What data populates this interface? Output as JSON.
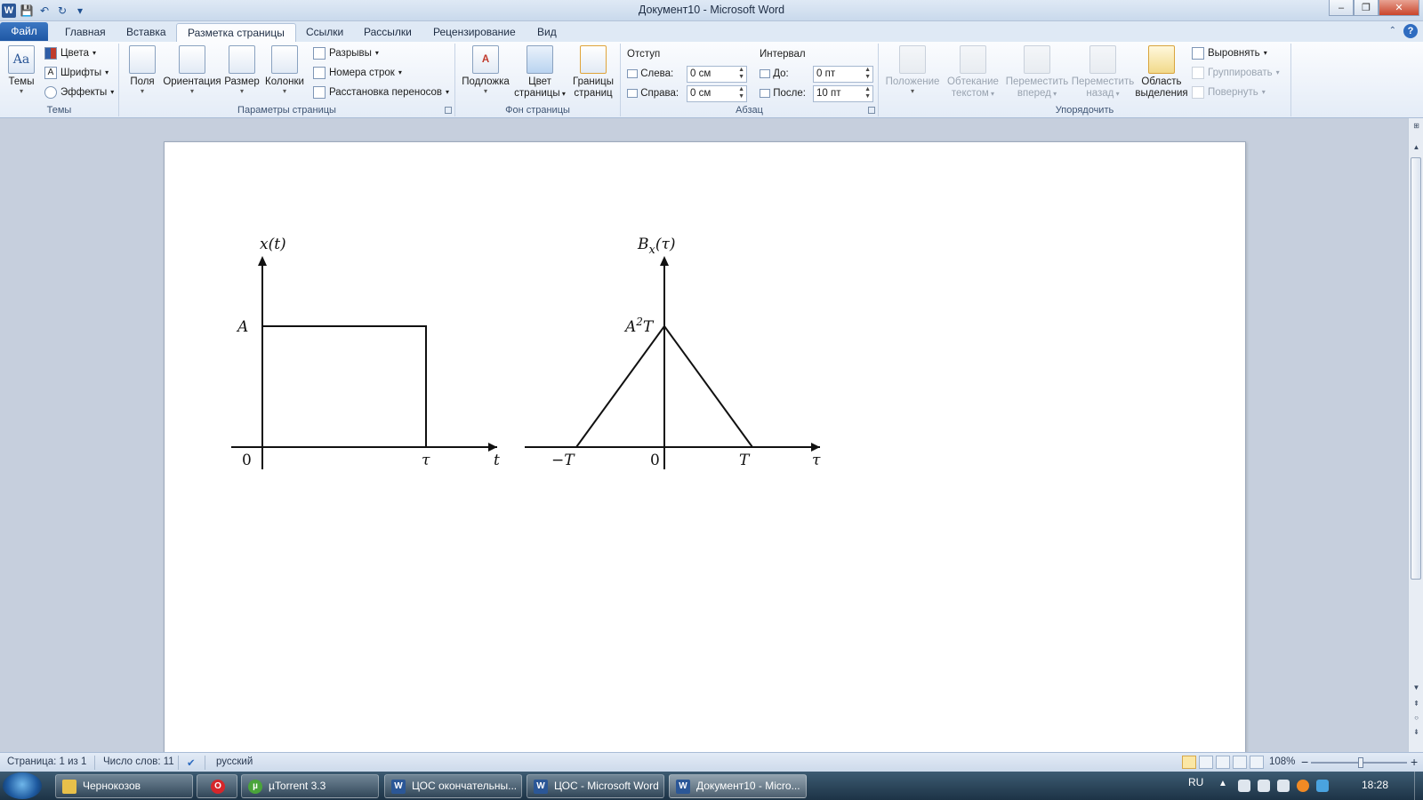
{
  "window": {
    "title": "Документ10  -  Microsoft Word",
    "controls": {
      "minimize": "–",
      "maximize": "❐",
      "close": "✕"
    }
  },
  "quick_access": {
    "app_icon": "W",
    "save": "💾",
    "undo": "↶",
    "redo": "↻",
    "customize": "▾"
  },
  "tabs": [
    "Файл",
    "Главная",
    "Вставка",
    "Разметка страницы",
    "Ссылки",
    "Рассылки",
    "Рецензирование",
    "Вид"
  ],
  "active_tab": "Разметка страницы",
  "ribbon": {
    "themes": {
      "label": "Темы",
      "themes_btn": "Темы",
      "colors": "Цвета",
      "fonts": "Шрифты",
      "effects": "Эффекты"
    },
    "page_setup": {
      "label": "Параметры страницы",
      "margins": "Поля",
      "orientation": "Ориентация",
      "size": "Размер",
      "columns": "Колонки",
      "breaks": "Разрывы",
      "line_numbers": "Номера строк",
      "hyphenation": "Расстановка переносов"
    },
    "page_background": {
      "label": "Фон страницы",
      "watermark": "Подложка",
      "page_color_1": "Цвет",
      "page_color_2": "страницы",
      "page_borders_1": "Границы",
      "page_borders_2": "страниц"
    },
    "paragraph": {
      "label": "Абзац",
      "indent_label": "Отступ",
      "left_label": "Слева:",
      "left_value": "0 см",
      "right_label": "Справа:",
      "right_value": "0 см",
      "spacing_label": "Интервал",
      "before_label": "До:",
      "before_value": "0 пт",
      "after_label": "После:",
      "after_value": "10 пт"
    },
    "arrange": {
      "label": "Упорядочить",
      "position_1": "Положение",
      "wrap_1": "Обтекание",
      "wrap_2": "текстом",
      "forward_1": "Переместить",
      "forward_2": "вперед",
      "backward_1": "Переместить",
      "backward_2": "назад",
      "selection_1": "Область",
      "selection_2": "выделения",
      "align": "Выровнять",
      "group": "Группировать",
      "rotate": "Повернуть"
    }
  },
  "figure_left": {
    "y_label": "x(t)",
    "amp_label": "A",
    "origin": "0",
    "tau_label": "τ",
    "x_label": "t",
    "amplitude": "A",
    "pulse_start": 0,
    "pulse_end": "τ"
  },
  "figure_right": {
    "y_label_main": "B",
    "y_label_sub": "x",
    "y_label_arg": "(τ)",
    "peak_label_a": "A",
    "peak_label_exp": "2",
    "peak_label_t": "T",
    "neg_T": "−T",
    "origin": "0",
    "pos_T": "T",
    "x_label": "τ"
  },
  "statusbar": {
    "page": "Страница: 1 из 1",
    "words": "Число слов: 11",
    "language": "русский",
    "zoom": "108%",
    "zoom_minus": "−",
    "zoom_plus": "+"
  },
  "taskbar": {
    "items": [
      {
        "label": "Чернокозов",
        "icon": "folder-icon",
        "color": "#e8c04a"
      },
      {
        "label": "",
        "icon": "opera-icon",
        "color": "#d6262b"
      },
      {
        "label": "µTorrent 3.3",
        "icon": "utorrent-icon",
        "color": "#4aa43a"
      },
      {
        "label": "ЦОС окончательны...",
        "icon": "word-icon",
        "color": "#2b5797"
      },
      {
        "label": "ЦОС - Microsoft Word",
        "icon": "word-icon",
        "color": "#2b5797"
      },
      {
        "label": "Документ10 - Micro...",
        "icon": "word-icon",
        "color": "#2b5797"
      }
    ],
    "lang": "RU",
    "clock": "18:28"
  }
}
